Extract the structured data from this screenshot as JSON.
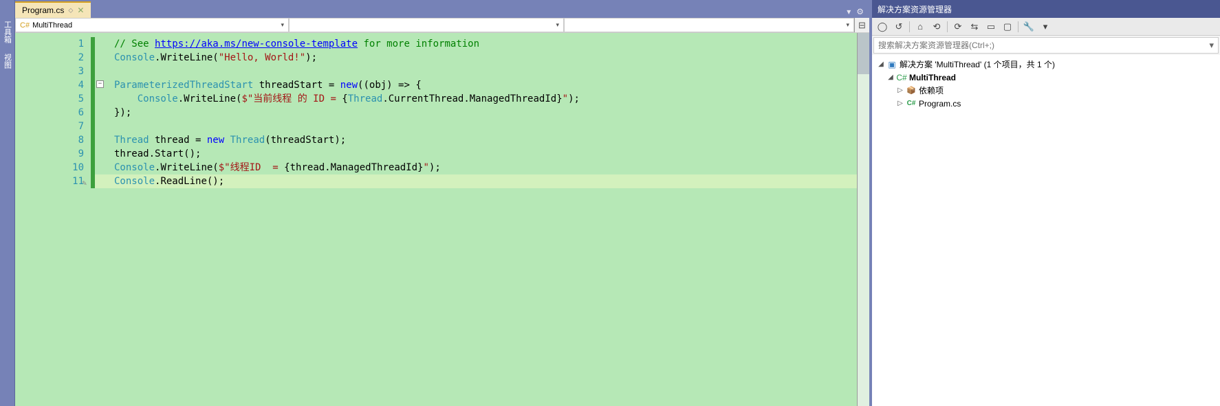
{
  "tab": {
    "name": "Program.cs",
    "pin": "⬦",
    "close": "✕"
  },
  "nav": {
    "dropdown1": "MultiThread"
  },
  "gutter": [
    "1",
    "2",
    "3",
    "4",
    "5",
    "6",
    "7",
    "8",
    "9",
    "10",
    "11"
  ],
  "fold_glyph": "−",
  "code": {
    "l1_comment": "// See ",
    "l1_link": "https://aka.ms/new-console-template",
    "l1_rest": " for more information",
    "l2a": "Console",
    "l2b": ".WriteLine(",
    "l2c": "\"Hello, World!\"",
    "l2d": ");",
    "l4a": "ParameterizedThreadStart",
    "l4b": " threadStart = ",
    "l4c": "new",
    "l4d": "((obj) => {",
    "l5a": "    Console",
    "l5b": ".WriteLine(",
    "l5c": "$\"当前线程 的 ID = ",
    "l5d": "{",
    "l5e": "Thread",
    "l5f": ".CurrentThread.ManagedThreadId",
    "l5g": "}",
    "l5h": "\"",
    "l5i": ");",
    "l6": "});",
    "l8a": "Thread",
    "l8b": " thread = ",
    "l8c": "new",
    "l8d": " ",
    "l8e": "Thread",
    "l8f": "(threadStart);",
    "l9": "thread.Start();",
    "l10a": "Console",
    "l10b": ".WriteLine(",
    "l10c": "$\"线程ID  = ",
    "l10d": "{",
    "l10e": "thread.ManagedThreadId",
    "l10f": "}",
    "l10g": "\"",
    "l10h": ");",
    "l11a": "Console",
    "l11b": ".ReadLine();"
  },
  "solution": {
    "panel_title": "解决方案资源管理器",
    "search_placeholder": "搜索解决方案资源管理器(Ctrl+;)",
    "root": "解决方案 'MultiThread' (1 个项目，共 1 个)",
    "project": "MultiThread",
    "deps": "依赖项",
    "file": "Program.cs"
  },
  "left_tabs": [
    "工具箱",
    "视图"
  ]
}
